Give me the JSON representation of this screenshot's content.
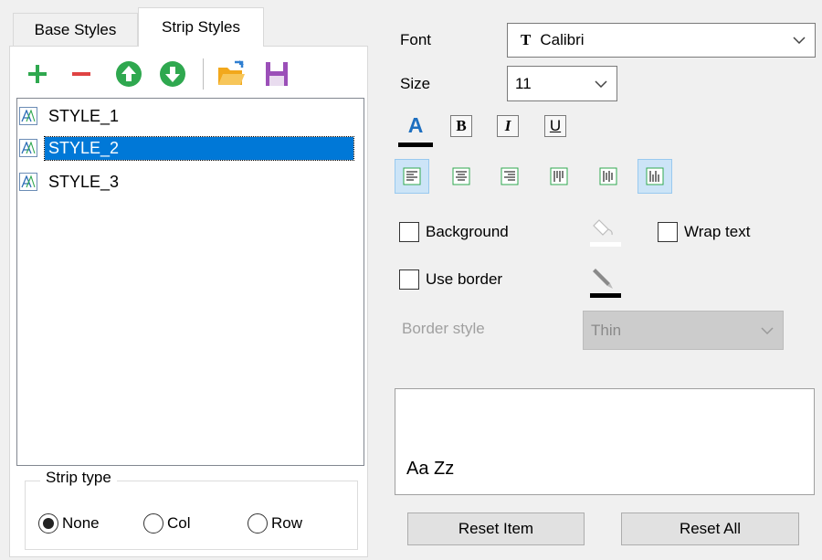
{
  "tabs": [
    {
      "label": "Base Styles",
      "active": false
    },
    {
      "label": "Strip Styles",
      "active": true
    }
  ],
  "toolbar": {
    "icons": [
      "add-icon",
      "remove-icon",
      "move-up-icon",
      "move-down-icon",
      "open-folder-icon",
      "save-icon"
    ],
    "colors": {
      "add": "#2fa84f",
      "remove": "#e04343",
      "move": "#2fa84f",
      "folder": "#f2a81c",
      "save": "#9b4fb8"
    }
  },
  "styles": {
    "items": [
      {
        "label": "STYLE_1",
        "selected": false
      },
      {
        "label": "STYLE_2",
        "selected": true
      },
      {
        "label": "STYLE_3",
        "selected": false
      }
    ]
  },
  "strip_type": {
    "title": "Strip type",
    "options": [
      {
        "label": "None",
        "checked": true
      },
      {
        "label": "Col",
        "checked": false
      },
      {
        "label": "Row",
        "checked": false
      }
    ]
  },
  "font": {
    "label": "Font",
    "value": "Calibri"
  },
  "size": {
    "label": "Size",
    "value": "11"
  },
  "format": {
    "color_glyph": "A",
    "bold": "B",
    "italic": "I",
    "underline": "U",
    "font_color": "#1e6fc0"
  },
  "alignment": {
    "buttons": [
      "align-left-icon",
      "align-center-icon",
      "align-right-icon",
      "valign-top-icon",
      "valign-middle-icon",
      "valign-bottom-icon"
    ],
    "active": [
      0,
      5
    ]
  },
  "options": {
    "background": {
      "label": "Background",
      "checked": false
    },
    "wrap_text": {
      "label": "Wrap text",
      "checked": false
    },
    "use_border": {
      "label": "Use border",
      "checked": false
    }
  },
  "border_style": {
    "label": "Border style",
    "value": "Thin",
    "disabled": true
  },
  "preview": {
    "text": "Aa Zz"
  },
  "buttons": {
    "reset_item": "Reset Item",
    "reset_all": "Reset All"
  },
  "colors": {
    "selection": "#0078d7",
    "panel_bg": "#f0f0f0",
    "active_toggle": "#cce4f7"
  }
}
